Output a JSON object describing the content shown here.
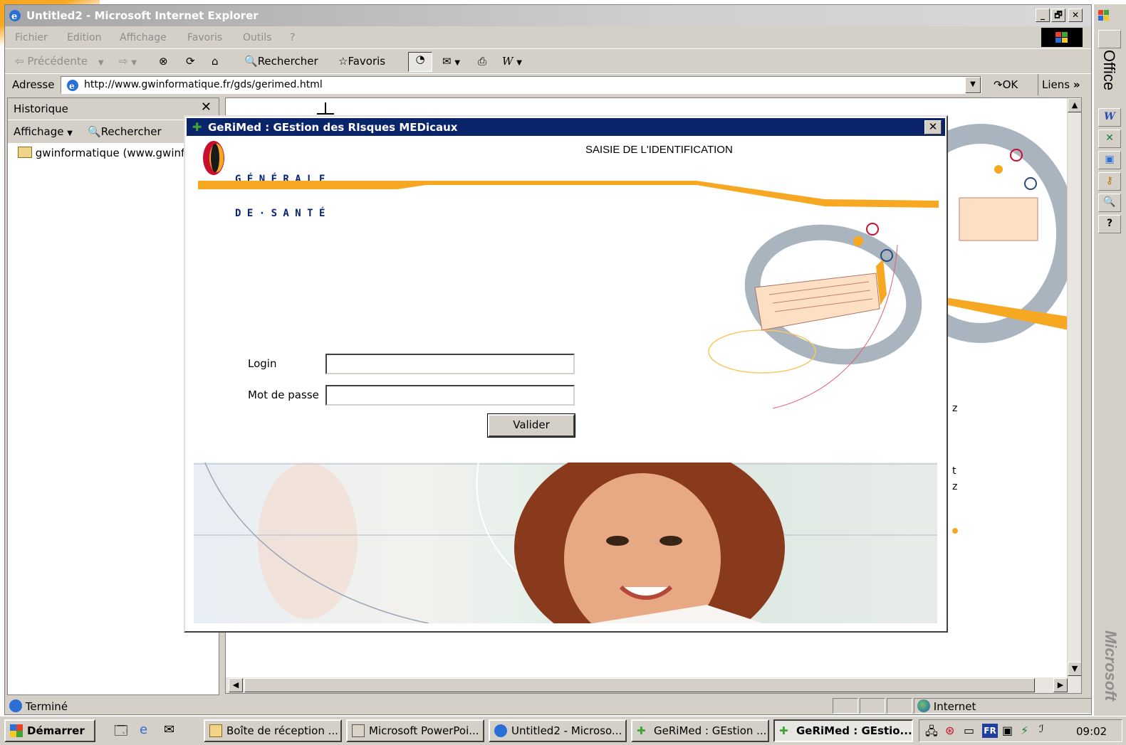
{
  "window": {
    "title": "Untitled2 - Microsoft Internet Explorer",
    "btn_min": "_",
    "btn_max": "🗗",
    "btn_close": "✕"
  },
  "menubar": {
    "items": [
      "Fichier",
      "Edition",
      "Affichage",
      "Favoris",
      "Outils",
      "?"
    ]
  },
  "toolbar": {
    "back": "Précédente",
    "search": "Rechercher",
    "favorites": "Favoris"
  },
  "address": {
    "label": "Adresse",
    "url": "http://www.gwinformatique.fr/gds/gerimed.html",
    "go": "OK",
    "links": "Liens"
  },
  "sidebar": {
    "title": "Historique",
    "view_label": "Affichage",
    "search_label": "Rechercher",
    "items": [
      "gwinformatique (www.gwinf"
    ]
  },
  "dialog": {
    "title": "GeRiMed : GEstion des RIsques MEDicaux",
    "logo_line1": "G É N É R A L E",
    "logo_line2": "D E · S A N T É",
    "heading": "SAISIE DE L'IDENTIFICATION",
    "login_label": "Login",
    "login_value": "",
    "password_label": "Mot de passe",
    "password_value": "",
    "submit_label": "Valider",
    "colors": {
      "title_bg": "#0a246a",
      "brand_orange": "#f7a823",
      "brand_red": "#c8102e"
    }
  },
  "statusbar": {
    "status": "Terminé",
    "zone": "Internet"
  },
  "taskbar": {
    "start": "Démarrer",
    "tasks": [
      "Boîte de réception ...",
      "Microsoft PowerPoi...",
      "Untitled2 - Microso...",
      "GeRiMed : GEstion ...",
      "GeRiMed : GEstio..."
    ],
    "tray": {
      "lang": "FR",
      "clock": "09:02"
    }
  },
  "officebar": {
    "label": "Office",
    "watermark": "Microsoft"
  }
}
